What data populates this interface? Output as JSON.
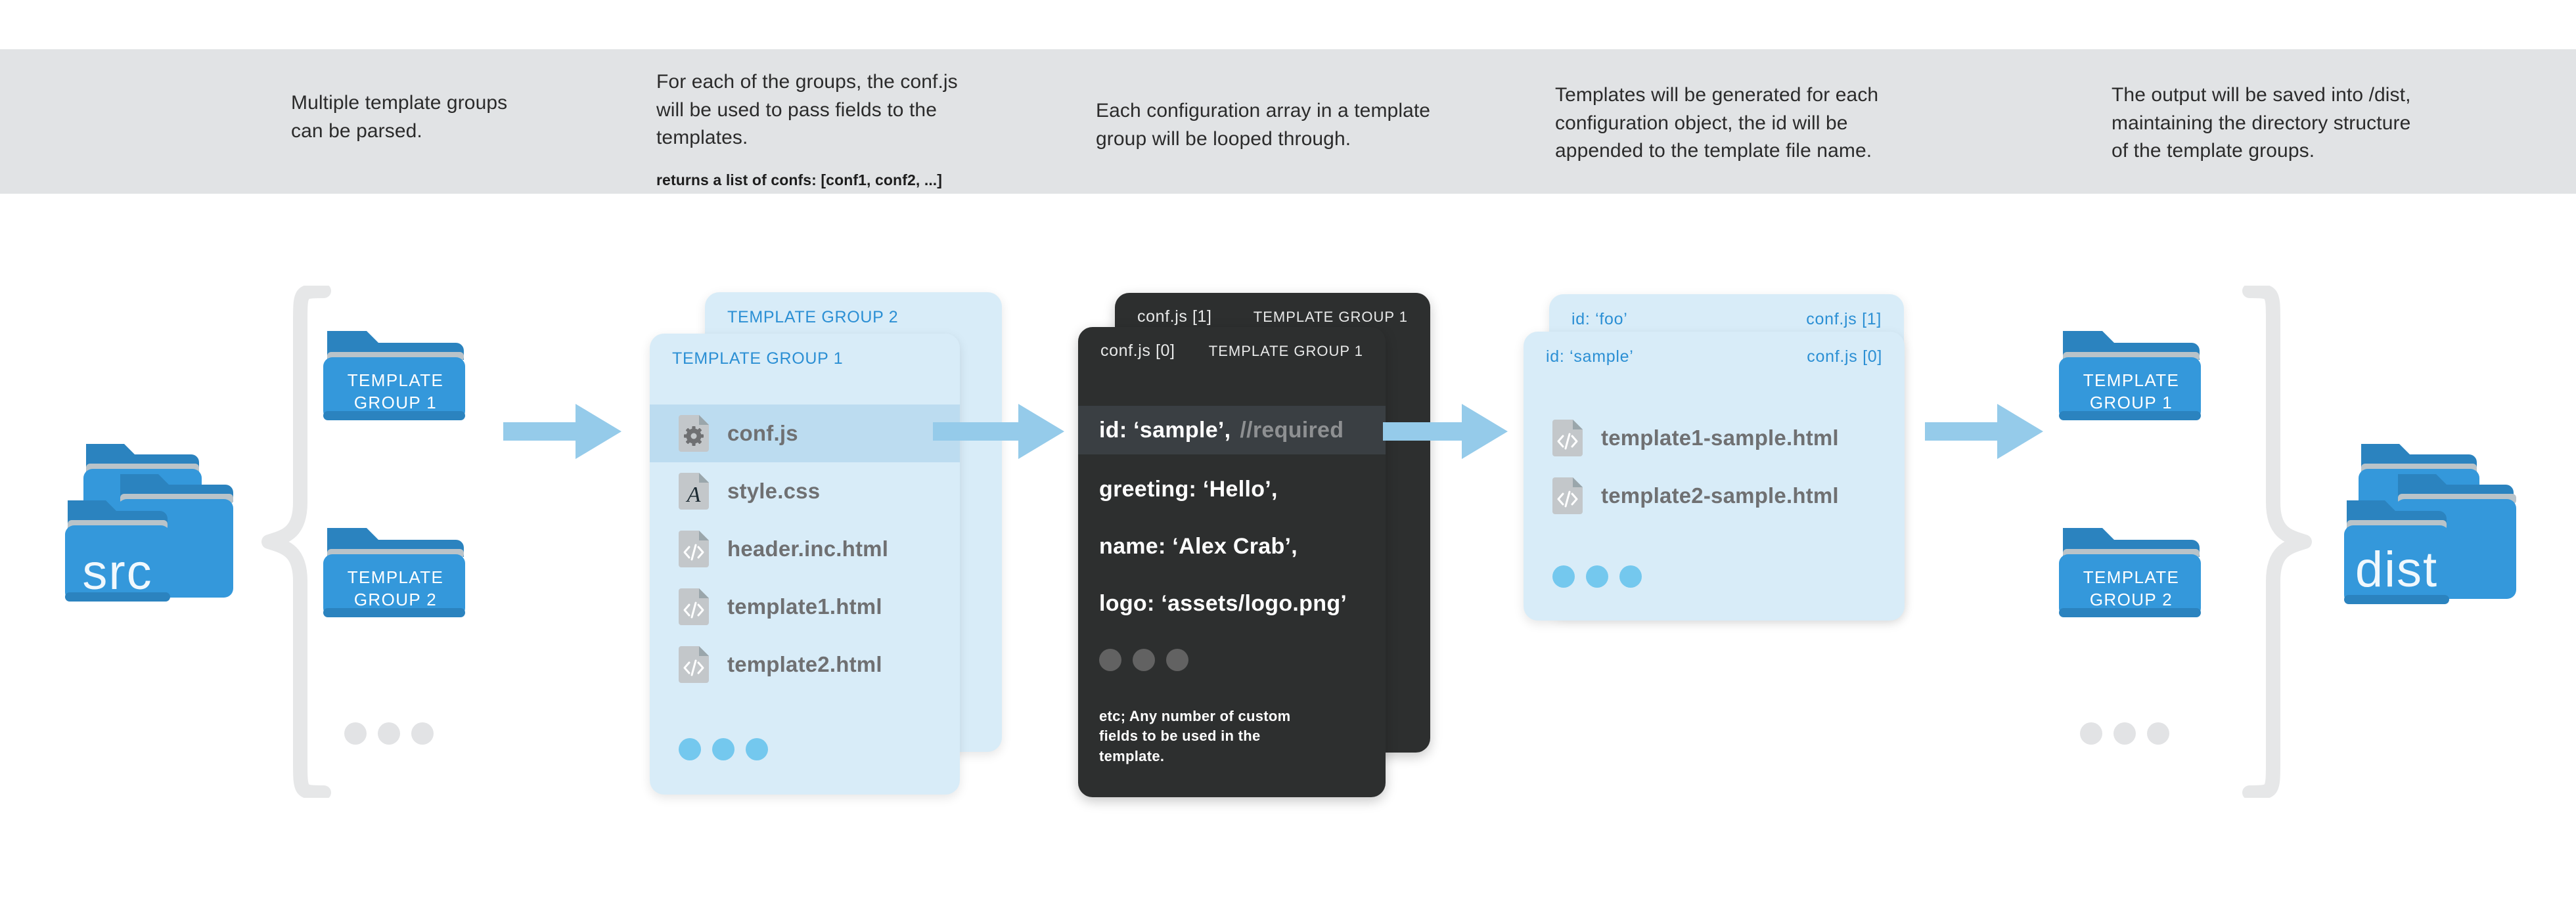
{
  "captions": [
    {
      "text": "Multiple template groups\ncan be parsed."
    },
    {
      "text": "For each of the groups, the conf.js\nwill be used to pass fields to the\ntemplates.",
      "sub": "returns a list of confs: [conf1, conf2, ...]"
    },
    {
      "text": "Each configuration array in a template\ngroup will be looped through."
    },
    {
      "text": "Templates will be generated for each\nconfiguration object, the id will be\nappended to the template file name."
    },
    {
      "text": "The output will be saved into /dist,\nmaintaining the directory structure\nof the template groups."
    }
  ],
  "stage1": {
    "src_folder_label": "src",
    "groups": [
      {
        "line1": "TEMPLATE",
        "line2": "GROUP 1"
      },
      {
        "line1": "TEMPLATE",
        "line2": "GROUP 2"
      }
    ]
  },
  "stage2": {
    "back_card_title": "TEMPLATE GROUP 2",
    "front_card_title": "TEMPLATE GROUP 1",
    "files": [
      {
        "name": "conf.js",
        "icon": "gear-file-icon",
        "selected": true
      },
      {
        "name": "style.css",
        "icon": "font-file-icon",
        "selected": false
      },
      {
        "name": "header.inc.html",
        "icon": "code-file-icon",
        "selected": false
      },
      {
        "name": "template1.html",
        "icon": "code-file-icon",
        "selected": false
      },
      {
        "name": "template2.html",
        "icon": "code-file-icon",
        "selected": false
      }
    ]
  },
  "stage3": {
    "back_card": {
      "left": "conf.js [1]",
      "right": "TEMPLATE GROUP 1"
    },
    "front_card": {
      "left": "conf.js [0]",
      "right": "TEMPLATE GROUP 1"
    },
    "code": [
      {
        "text": "id: ‘sample’,",
        "comment": "//required",
        "highlighted": true
      },
      {
        "text": "greeting: ‘Hello’,",
        "comment": "",
        "highlighted": false
      },
      {
        "text": "name: ‘Alex Crab’,",
        "comment": "",
        "highlighted": false
      },
      {
        "text": "logo: ‘assets/logo.png’",
        "comment": "",
        "highlighted": false
      }
    ],
    "note": "etc; Any number of custom\nfields to be used in the\ntemplate."
  },
  "stage4": {
    "back_card": {
      "left": "id: ‘foo’",
      "right": "conf.js [1]"
    },
    "front_card": {
      "left": "id: ‘sample’",
      "right": "conf.js [0]"
    },
    "files": [
      {
        "name": "template1-sample.html",
        "icon": "code-file-icon"
      },
      {
        "name": "template2-sample.html",
        "icon": "code-file-icon"
      }
    ]
  },
  "stage5": {
    "groups": [
      {
        "line1": "TEMPLATE",
        "line2": "GROUP 1"
      },
      {
        "line1": "TEMPLATE",
        "line2": "GROUP 2"
      }
    ],
    "dist_folder_label": "dist"
  },
  "colors": {
    "band": "#e1e3e5",
    "folder_blue": "#3498db",
    "folder_tab": "#2b83bf",
    "card_blue": "#d8ecf8",
    "card_blue_selected": "#bcdcf0",
    "card_dark": "#2d2f2f",
    "code_highlight": "#3a3f43",
    "accent_text_blue": "#2b8fd4",
    "arrow_blue": "#95cbea",
    "dot_blue": "#74c8ee",
    "brace_grey": "#e6e7e8",
    "file_icon_grey": "#c3c7ca"
  }
}
